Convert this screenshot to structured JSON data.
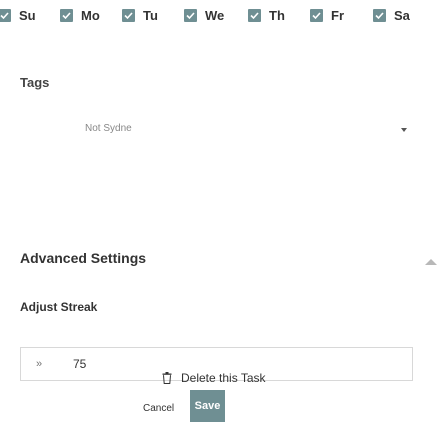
{
  "days": [
    {
      "label": "Su",
      "checked": true
    },
    {
      "label": "Mo",
      "checked": true
    },
    {
      "label": "Tu",
      "checked": true
    },
    {
      "label": "We",
      "checked": true
    },
    {
      "label": "Th",
      "checked": true
    },
    {
      "label": "Fr",
      "checked": true
    },
    {
      "label": "Sa",
      "checked": true
    }
  ],
  "tags": {
    "label": "Tags",
    "placeholder": "Not Sydne"
  },
  "advanced": {
    "title": "Advanced Settings",
    "expanded": true,
    "streak_label": "Adjust Streak",
    "streak_icon": "»",
    "streak_value": "75"
  },
  "actions": {
    "delete_label": "Delete this Task",
    "cancel_label": "Cancel",
    "save_label": "Save"
  },
  "colors": {
    "accent": "#6f8f93"
  }
}
